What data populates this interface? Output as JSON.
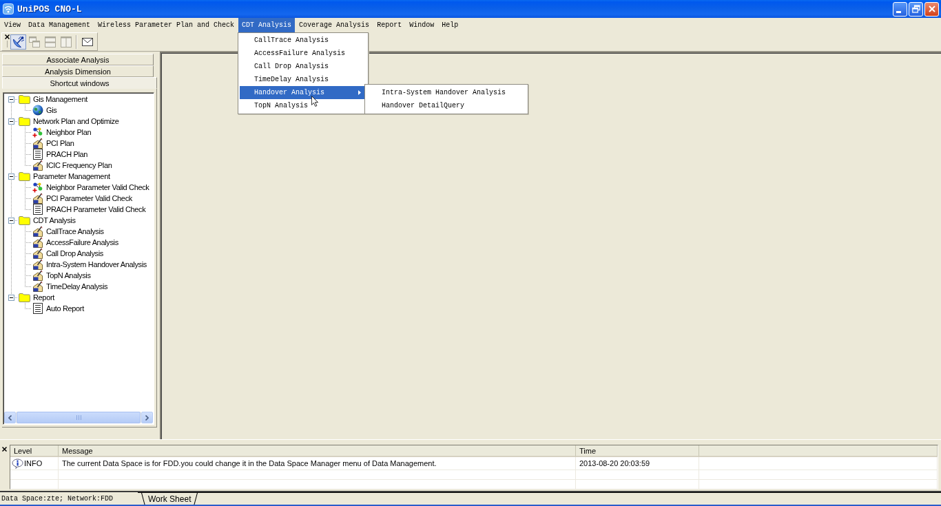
{
  "window": {
    "title": "UniPOS CNO-L"
  },
  "menu_bar": [
    {
      "label": "View",
      "selected": false
    },
    {
      "label": "Data Management",
      "selected": false
    },
    {
      "label": "Wireless Parameter Plan and Check",
      "selected": false
    },
    {
      "label": "CDT Analysis",
      "selected": true,
      "menu": {
        "items": [
          {
            "label": "CallTrace Analysis",
            "selected": false
          },
          {
            "label": "AccessFailure Analysis",
            "selected": false
          },
          {
            "label": "Call Drop Analysis",
            "selected": false
          },
          {
            "label": "TimeDelay Analysis",
            "selected": false
          },
          {
            "label": "Handover Analysis",
            "selected": true,
            "submenu": {
              "items": [
                {
                  "label": "Intra-System Handover Analysis",
                  "selected": false
                },
                {
                  "label": "Handover DetailQuery",
                  "selected": false
                }
              ]
            }
          },
          {
            "label": "TopN Analysis",
            "selected": false
          }
        ]
      }
    },
    {
      "label": "Coverage Analysis",
      "selected": false
    },
    {
      "label": "Report",
      "selected": false
    },
    {
      "label": "Window",
      "selected": false
    },
    {
      "label": "Help",
      "selected": false
    }
  ],
  "toolbar": {
    "groups": [
      [
        {
          "kind": "antenna",
          "pressed": true,
          "disabled": false
        },
        {
          "kind": "cascade",
          "pressed": false,
          "disabled": true
        },
        {
          "kind": "tile_horizontal",
          "pressed": false,
          "disabled": true
        },
        {
          "kind": "tile_vertical",
          "pressed": false,
          "disabled": true
        }
      ],
      [
        {
          "kind": "mail",
          "pressed": false,
          "disabled": false
        }
      ]
    ]
  },
  "left_panel": {
    "sections": [
      {
        "label": "Associate Analysis",
        "selected": false
      },
      {
        "label": "Analysis Dimension",
        "selected": false
      },
      {
        "label": "Shortcut windows",
        "selected": true
      }
    ],
    "tree": [
      {
        "label": "Gis Management",
        "expanded": true,
        "selected": false,
        "children": [
          {
            "label": "Gis",
            "kind": "map",
            "selected": false
          }
        ]
      },
      {
        "label": "Network Plan and Optimize",
        "expanded": true,
        "selected": false,
        "children": [
          {
            "label": "Neighbor Plan",
            "kind": "neighbor",
            "selected": false
          },
          {
            "label": "PCI Plan",
            "kind": "plan",
            "selected": false
          },
          {
            "label": "PRACH Plan",
            "kind": "table",
            "selected": false
          },
          {
            "label": "ICIC Frequency Plan",
            "kind": "plan",
            "selected": false
          }
        ]
      },
      {
        "label": "Parameter Management",
        "expanded": true,
        "selected": false,
        "children": [
          {
            "label": "Neighbor Parameter Valid Check",
            "kind": "neighbor",
            "selected": false
          },
          {
            "label": "PCI Parameter Valid Check",
            "kind": "plan",
            "selected": false
          },
          {
            "label": "PRACH Parameter Valid Check",
            "kind": "table",
            "selected": false
          }
        ]
      },
      {
        "label": "CDT Analysis",
        "expanded": true,
        "selected": false,
        "children": [
          {
            "label": "CallTrace Analysis",
            "kind": "plan",
            "selected": false
          },
          {
            "label": "AccessFailure Analysis",
            "kind": "plan",
            "selected": false
          },
          {
            "label": "Call Drop Analysis",
            "kind": "plan",
            "selected": false
          },
          {
            "label": "Intra-System Handover Analysis",
            "kind": "plan",
            "selected": false
          },
          {
            "label": "TopN Analysis",
            "kind": "plan",
            "selected": false
          },
          {
            "label": "TimeDelay Analysis",
            "kind": "plan",
            "selected": false
          }
        ]
      },
      {
        "label": "Report",
        "expanded": true,
        "selected": false,
        "children": [
          {
            "label": "Auto Report",
            "kind": "table",
            "selected": false
          }
        ]
      }
    ]
  },
  "log": {
    "columns": [
      "Level",
      "Message",
      "Time"
    ],
    "rows": [
      {
        "level": "INFO",
        "message": "The current Data Space is for FDD.you could change it in the Data Space Manager menu of Data Management.",
        "time": "2013-08-20 20:03:59",
        "selected": false
      }
    ]
  },
  "status_bar": {
    "text": "Data Space:zte; Network:FDD",
    "tabs": [
      {
        "label": "Work Sheet",
        "selected": true
      }
    ]
  }
}
